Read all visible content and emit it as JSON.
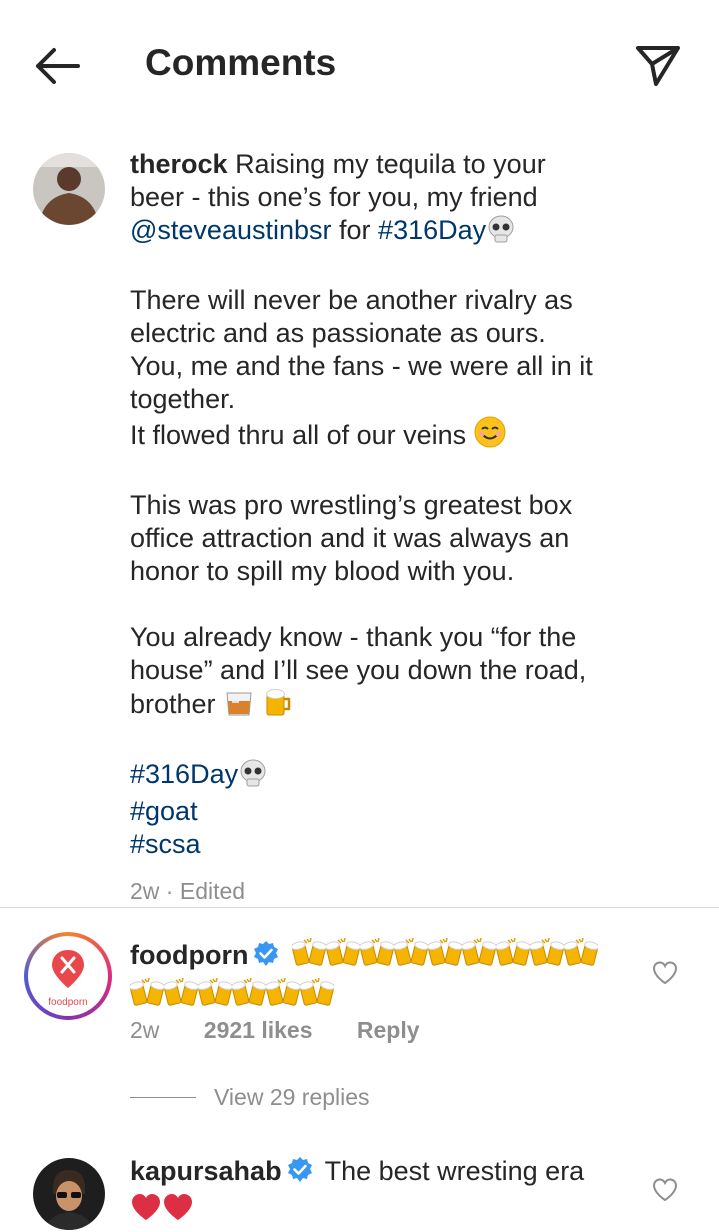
{
  "header": {
    "title": "Comments",
    "back_icon": "arrow-left-icon",
    "send_icon": "paper-plane-icon"
  },
  "post": {
    "username": "therock",
    "lines_p1": [
      "Raising my tequila to your",
      "beer - this  one’s for you, my friend"
    ],
    "mention": "@steveaustinbsr",
    "for_word": "for",
    "hashtag_main": "#316Day",
    "p2": [
      "There will never be another rivalry as",
      "electric and as passionate as ours.",
      "You, me and the fans - we were all in it",
      "together.",
      "It flowed thru all of our veins"
    ],
    "p3": [
      "This was pro wrestling’s greatest box",
      "office attraction and it was always an",
      "honor to spill my blood with you."
    ],
    "p4": [
      "You already know - thank you “for the",
      "house” and I’ll see you down the road,",
      "brother"
    ],
    "hashtags": [
      "#316Day",
      "#goat",
      "#scsa"
    ],
    "time": "2w",
    "edited": "Edited"
  },
  "comments": [
    {
      "username": "foodporn",
      "avatar_label": "foodporn",
      "verified": true,
      "text_emoji": "clinking-beer-mugs x 14",
      "time": "2w",
      "likes": "2921 likes",
      "reply_label": "Reply",
      "view_replies": "View 29 replies"
    },
    {
      "username": "kapursahab",
      "verified": true,
      "text": "The best wresting era",
      "text_emoji": "red-heart x 2"
    }
  ],
  "colors": {
    "link": "#00376b",
    "text": "#262626",
    "muted": "#8e8e8e",
    "verified": "#3897f0",
    "foodporn_red": "#e8474c"
  }
}
